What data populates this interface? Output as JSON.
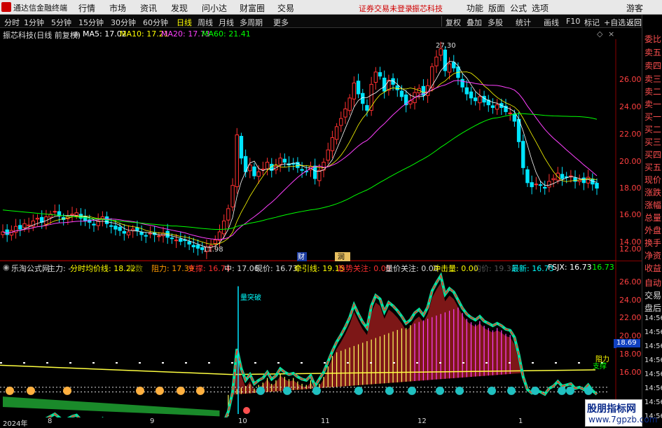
{
  "app": {
    "title": "通达信金融终端",
    "menu": [
      "行情",
      "市场",
      "资讯",
      "发现",
      "问小达",
      "财富圈",
      "交易"
    ],
    "warn": [
      "证券交易未登录",
      "振芯科技"
    ],
    "right_menu": [
      "功能",
      "版面",
      "公式",
      "选项",
      "游客"
    ]
  },
  "periods": [
    "分时",
    "1分钟",
    "5分钟",
    "15分钟",
    "30分钟",
    "60分钟",
    "日线",
    "周线",
    "月线",
    "多周期",
    "更多"
  ],
  "active_period": "日线",
  "toolbar_right": [
    "复权",
    "叠加",
    "多股",
    "统计",
    "画线",
    "F10",
    "标记",
    "+自选",
    "返回"
  ],
  "right_col": [
    "委比",
    "卖五",
    "卖四",
    "卖三",
    "卖二",
    "卖一",
    "买一",
    "买二",
    "买三",
    "买四",
    "买五",
    "现价",
    "涨跌",
    "涨幅",
    "总量",
    "外盘",
    "换手",
    "净资",
    "收益",
    "自动",
    "交易",
    "盘后",
    "14:56",
    "14:56",
    "14:56",
    "14:56",
    "14:56",
    "14:56",
    "14:56",
    "14:56"
  ],
  "main_legend": {
    "name": "振芯科技(日线 前复权)",
    "ma5": "MA5: 17.02",
    "ma10": "MA10: 17.21",
    "ma20": "MA20: 17.73",
    "ma60": "MA60: 21.41"
  },
  "y_main": [
    "26.00",
    "24.00",
    "22.00",
    "20.00",
    "18.00",
    "16.00",
    "14.00",
    "12.00"
  ],
  "y_sub": [
    "26.00",
    "24.00",
    "22.00",
    "20.00",
    "18.00",
    "16.00"
  ],
  "annot": {
    "high": "27.30",
    "low": "11.98",
    "cai": "财",
    "run": "润",
    "breakout": "量突破",
    "zhili": "阻力",
    "zhicheng": "支撑",
    "fs_price": "18.69"
  },
  "sub_legend": {
    "f": "乐淘公式网",
    "a": "主力: -",
    "b": "分时均价线: 18.22",
    "c": "常数",
    "d": "阻力: 17.39",
    "e": "支撑: 16.74",
    "g": "中: 17.06",
    "h": "现价: 16.73",
    "i": "牵引线: 19.15",
    "j": "趋势关注: 0.00",
    "k": "量价关注: 0.00",
    "l": "冲击量: 0.00",
    "m": "均价: 19.32",
    "n": "最新: 16.73",
    "o": "FSJX: 16.73",
    "p": ": 16.73"
  },
  "x_axis": [
    "2024年",
    "8",
    "9",
    "10",
    "11",
    "12",
    "1"
  ],
  "watermark": {
    "a": "股朋指标网",
    "b": "www.7gpzb.com"
  },
  "colors": {
    "up": "#ff3030",
    "down": "#00e5ff",
    "ma5": "#ffffff",
    "ma10": "#ffff00",
    "ma20": "#ff00ff",
    "ma60": "#00ff00"
  },
  "chart_data": {
    "type": "candlestick",
    "ylim": [
      11.5,
      27.5
    ],
    "close": [
      13.5,
      13.3,
      13.6,
      13.9,
      13.7,
      14.1,
      14.0,
      14.3,
      14.5,
      14.2,
      14.6,
      14.8,
      15.0,
      14.7,
      14.4,
      14.6,
      14.8,
      14.9,
      14.5,
      14.3,
      14.2,
      14.0,
      14.3,
      14.6,
      14.1,
      13.9,
      13.7,
      13.6,
      13.4,
      13.5,
      13.7,
      13.6,
      13.3,
      13.2,
      13.4,
      13.3,
      13.2,
      13.4,
      13.1,
      13.0,
      12.9,
      12.8,
      12.9,
      12.6,
      12.4,
      12.3,
      12.2,
      12.4,
      12.5,
      12.9,
      13.5,
      14.3,
      15.2,
      16.9,
      20.6,
      18.9,
      17.9,
      18.4,
      17.6,
      17.9,
      18.1,
      18.6,
      18.0,
      18.3,
      18.9,
      18.6,
      18.4,
      18.5,
      18.2,
      18.0,
      17.9,
      18.3,
      17.4,
      18.0,
      18.6,
      19.5,
      20.4,
      21.2,
      21.8,
      22.5,
      23.3,
      24.4,
      23.6,
      22.9,
      22.4,
      24.3,
      25.2,
      24.9,
      23.8,
      24.6,
      24.3,
      23.9,
      23.4,
      22.8,
      23.1,
      23.7,
      24.0,
      23.5,
      24.2,
      25.6,
      26.3,
      26.9,
      25.3,
      25.8,
      25.5,
      24.8,
      24.1,
      23.6,
      23.3,
      23.1,
      23.4,
      23.0,
      22.8,
      22.6,
      22.8,
      22.6,
      22.3,
      22.2,
      21.6,
      20.1,
      18.2,
      17.1,
      16.8,
      17.0,
      16.9,
      16.7,
      17.2,
      17.4,
      17.8,
      17.4,
      17.5,
      17.6,
      17.2,
      17.3,
      17.1,
      17.5,
      17.0,
      16.7
    ]
  }
}
